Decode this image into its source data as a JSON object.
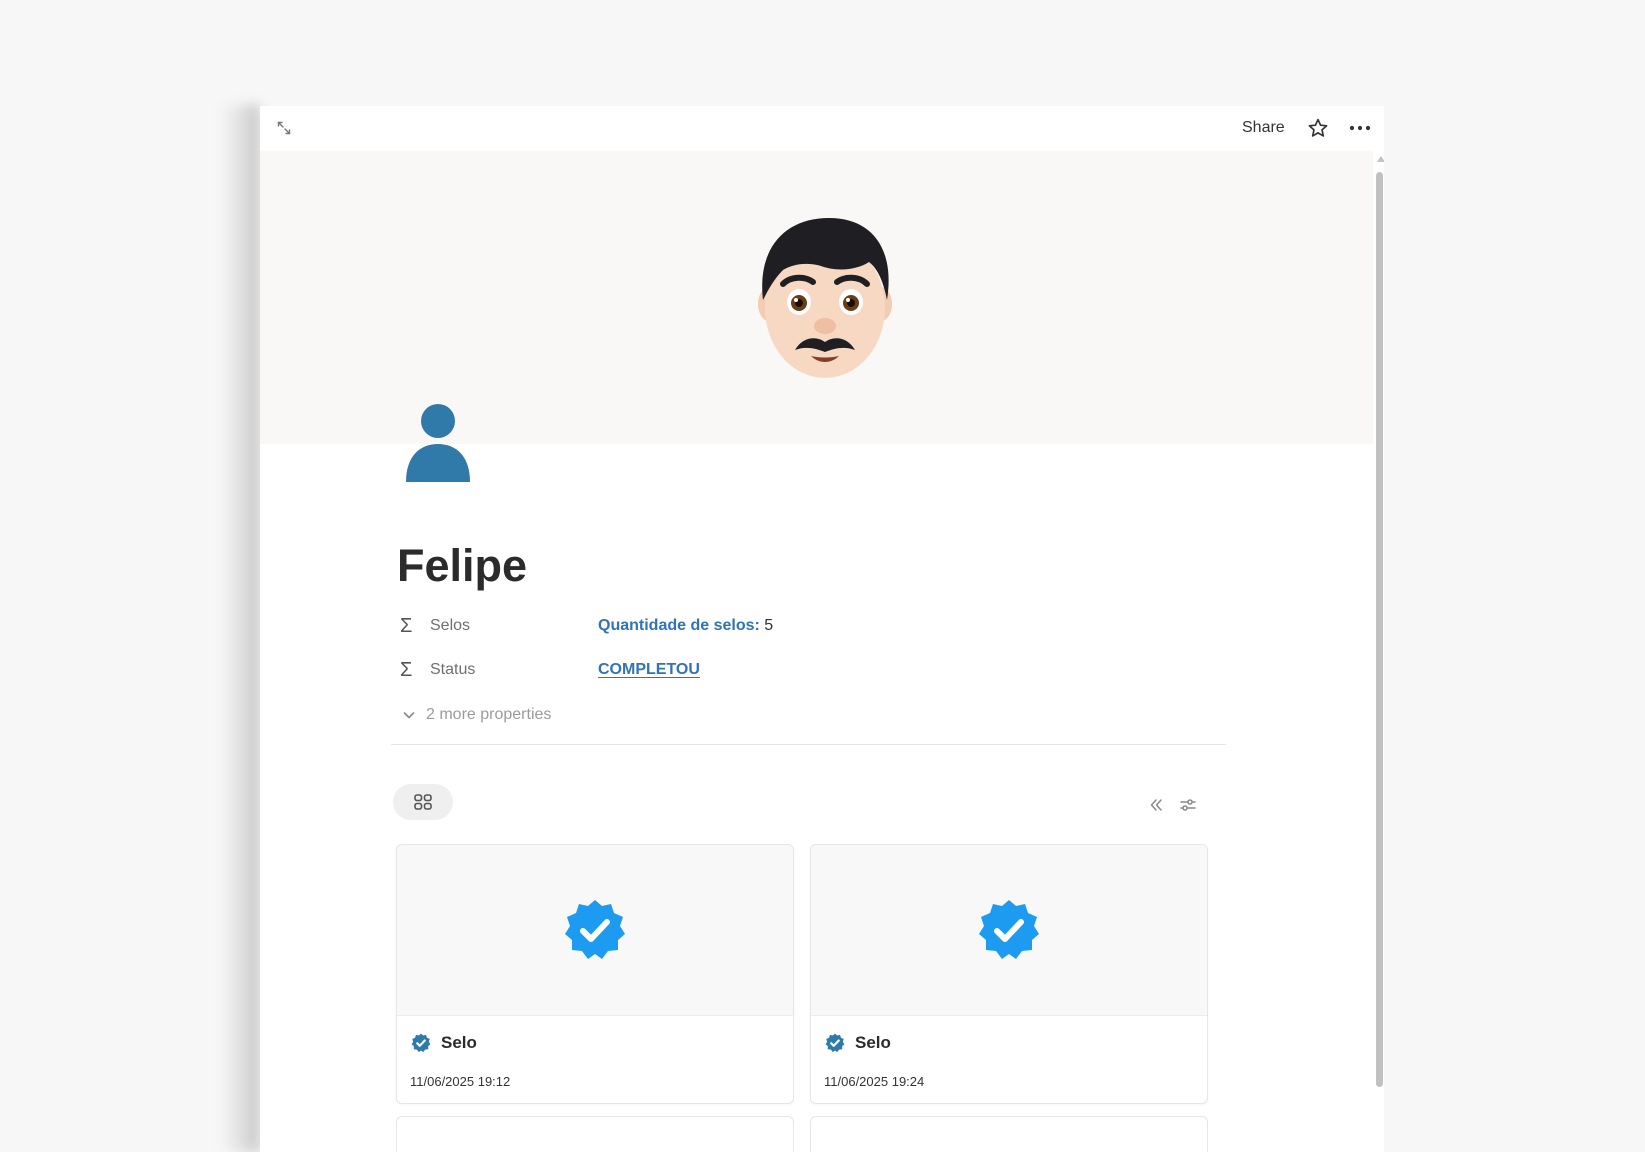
{
  "topbar": {
    "expand_icon": "expand-diagonal-icon",
    "share_label": "Share",
    "favorite_icon": "star-icon",
    "more_icon": "more-horizontal-icon"
  },
  "cover": {
    "emoji": "man-mustache-emoji",
    "background": "#f9f8f7"
  },
  "page": {
    "icon": "person-icon",
    "icon_color": "#2f7aa8",
    "title": "Felipe"
  },
  "properties": [
    {
      "icon": "sigma-icon",
      "name": "Selos",
      "value_label": "Quantidade de selos:",
      "value_number": "5"
    },
    {
      "icon": "sigma-icon",
      "name": "Status",
      "value": "COMPLETOU"
    }
  ],
  "more_properties": "2 more properties",
  "gallery": {
    "view_icon": "gallery-grid-icon",
    "collapse_icon": "double-chevron-left-icon",
    "settings_icon": "sliders-icon",
    "cards": [
      {
        "cover_icon": "verified-badge-icon",
        "title": "Selo",
        "date": "11/06/2025 19:12"
      },
      {
        "cover_icon": "verified-badge-icon",
        "title": "Selo",
        "date": "11/06/2025 19:24"
      }
    ]
  },
  "colors": {
    "accent": "#2f73bd",
    "badge": "#1d9bf0",
    "small_badge": "#2f7aa8"
  }
}
